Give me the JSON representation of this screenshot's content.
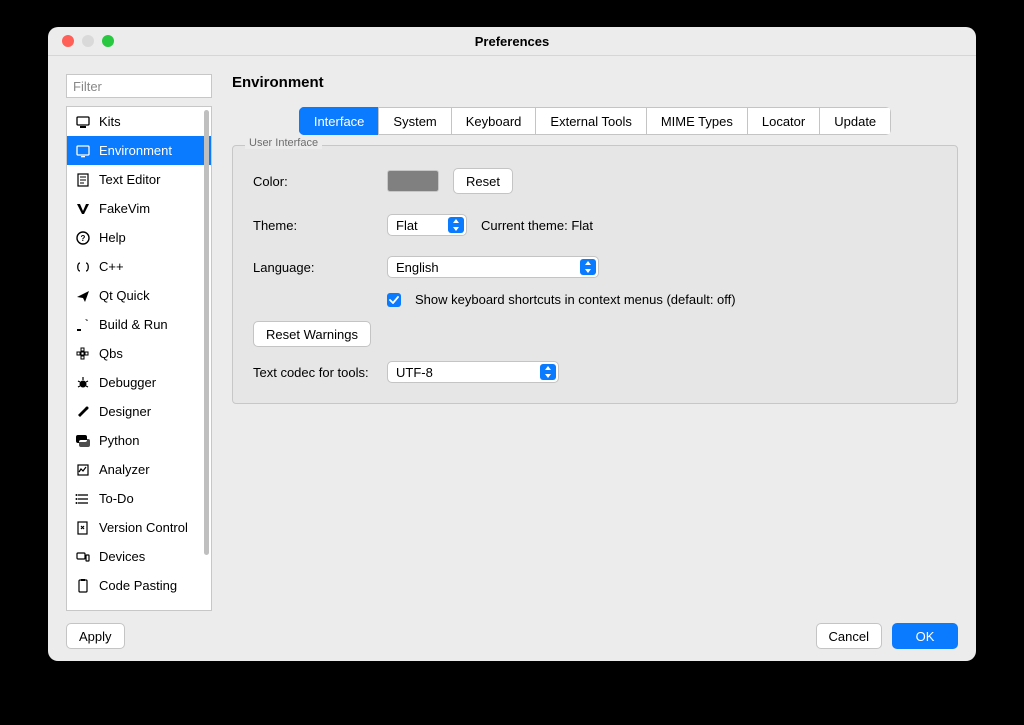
{
  "window_title": "Preferences",
  "filter": {
    "placeholder": "Filter"
  },
  "sidebar": {
    "items": [
      {
        "label": "Kits",
        "icon": "kits"
      },
      {
        "label": "Environment",
        "icon": "environment",
        "selected": true
      },
      {
        "label": "Text Editor",
        "icon": "text-editor"
      },
      {
        "label": "FakeVim",
        "icon": "fakevim"
      },
      {
        "label": "Help",
        "icon": "help"
      },
      {
        "label": "C++",
        "icon": "cpp"
      },
      {
        "label": "Qt Quick",
        "icon": "qtquick"
      },
      {
        "label": "Build & Run",
        "icon": "buildrun"
      },
      {
        "label": "Qbs",
        "icon": "qbs"
      },
      {
        "label": "Debugger",
        "icon": "debugger"
      },
      {
        "label": "Designer",
        "icon": "designer"
      },
      {
        "label": "Python",
        "icon": "python"
      },
      {
        "label": "Analyzer",
        "icon": "analyzer"
      },
      {
        "label": "To-Do",
        "icon": "todo"
      },
      {
        "label": "Version Control",
        "icon": "vcs"
      },
      {
        "label": "Devices",
        "icon": "devices"
      },
      {
        "label": "Code Pasting",
        "icon": "codepasting"
      }
    ]
  },
  "page": {
    "heading": "Environment",
    "tabs": [
      "Interface",
      "System",
      "Keyboard",
      "External Tools",
      "MIME Types",
      "Locator",
      "Update"
    ],
    "active_tab": 0,
    "group_label": "User Interface",
    "rows": {
      "color": {
        "label": "Color:",
        "reset_button": "Reset",
        "value": "#808080"
      },
      "theme": {
        "label": "Theme:",
        "value": "Flat",
        "current_label": "Current theme: Flat"
      },
      "language": {
        "label": "Language:",
        "value": "English"
      },
      "shortcuts_checkbox": {
        "checked": true,
        "label": "Show keyboard shortcuts in context menus (default: off)"
      },
      "reset_warnings_button": "Reset Warnings",
      "codec": {
        "label": "Text codec for tools:",
        "value": "UTF-8"
      }
    }
  },
  "footer": {
    "apply": "Apply",
    "cancel": "Cancel",
    "ok": "OK"
  }
}
